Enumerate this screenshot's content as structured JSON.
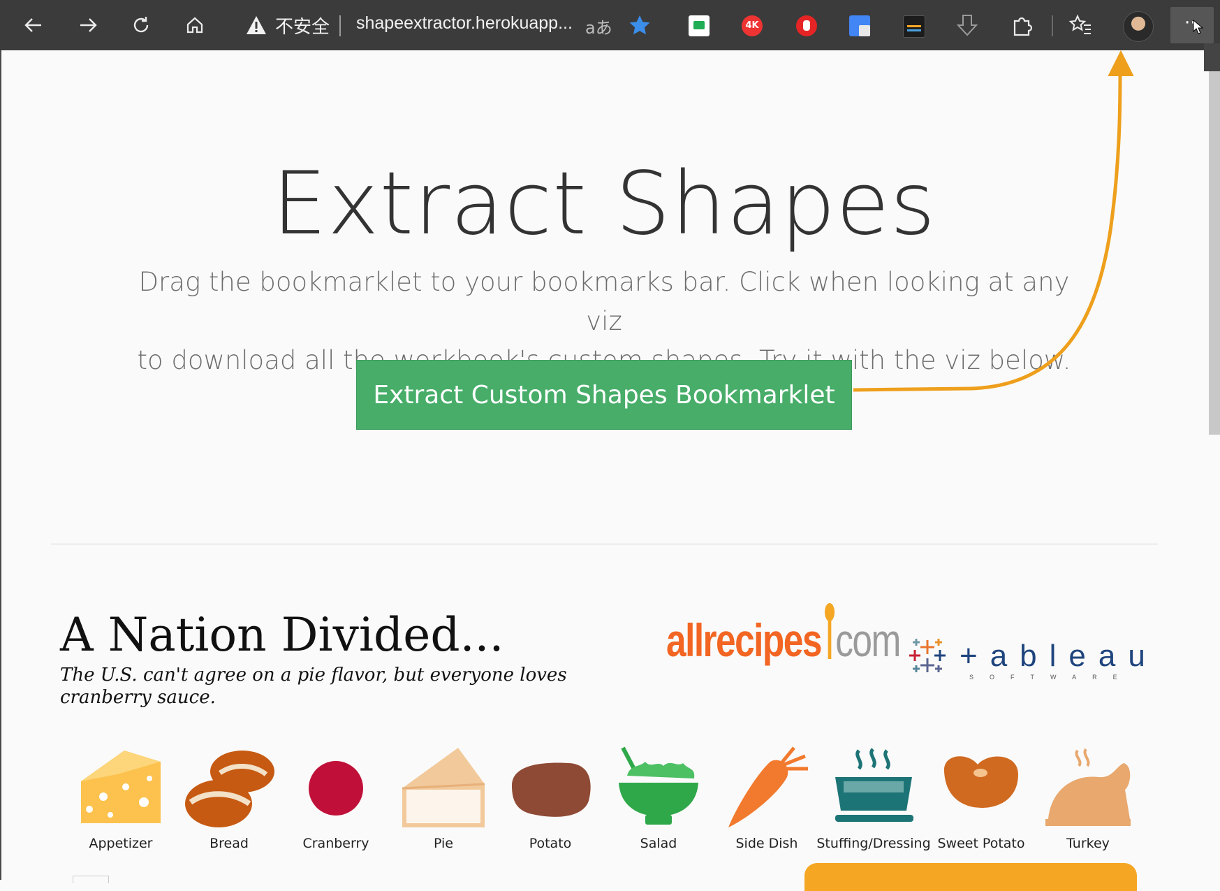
{
  "browser": {
    "security_label": "不安全",
    "url": "shapeextractor.herokuapp...",
    "read_aloud_label": "aあ"
  },
  "hero": {
    "title": "Extract Shapes",
    "subtitle_line1": "Drag the bookmarklet to your bookmarks bar. Click when looking at any viz",
    "subtitle_line2": "to download all the workbook's custom shapes. Try it with the viz below.",
    "button_label": "Extract Custom Shapes Bookmarklet"
  },
  "viz": {
    "title": "A Nation Divided...",
    "subtitle": "The U.S. can't agree on a pie flavor, but everyone loves cranberry sauce.",
    "allrecipes_brand": "allrecipes",
    "allrecipes_com": "com",
    "tableau_word": "+ableau",
    "tableau_software": "SOFTWARE",
    "shapes": [
      {
        "label": "Appetizer",
        "color": "#fcc24d"
      },
      {
        "label": "Bread",
        "color": "#c65a12"
      },
      {
        "label": "Cranberry",
        "color": "#c0103a"
      },
      {
        "label": "Pie",
        "color": "#f2c99a"
      },
      {
        "label": "Potato",
        "color": "#8e4a34"
      },
      {
        "label": "Salad",
        "color": "#2fa84a"
      },
      {
        "label": "Side Dish",
        "color": "#f27a2e"
      },
      {
        "label": "Stuffing/Dressing",
        "color": "#1d7476"
      },
      {
        "label": "Sweet Potato",
        "color": "#d06a20"
      },
      {
        "label": "Turkey",
        "color": "#e8a86e"
      }
    ]
  },
  "colors": {
    "toolbar": "#3b3b3b",
    "button_green": "#47ad69",
    "arrow_orange": "#ee9f1c"
  }
}
